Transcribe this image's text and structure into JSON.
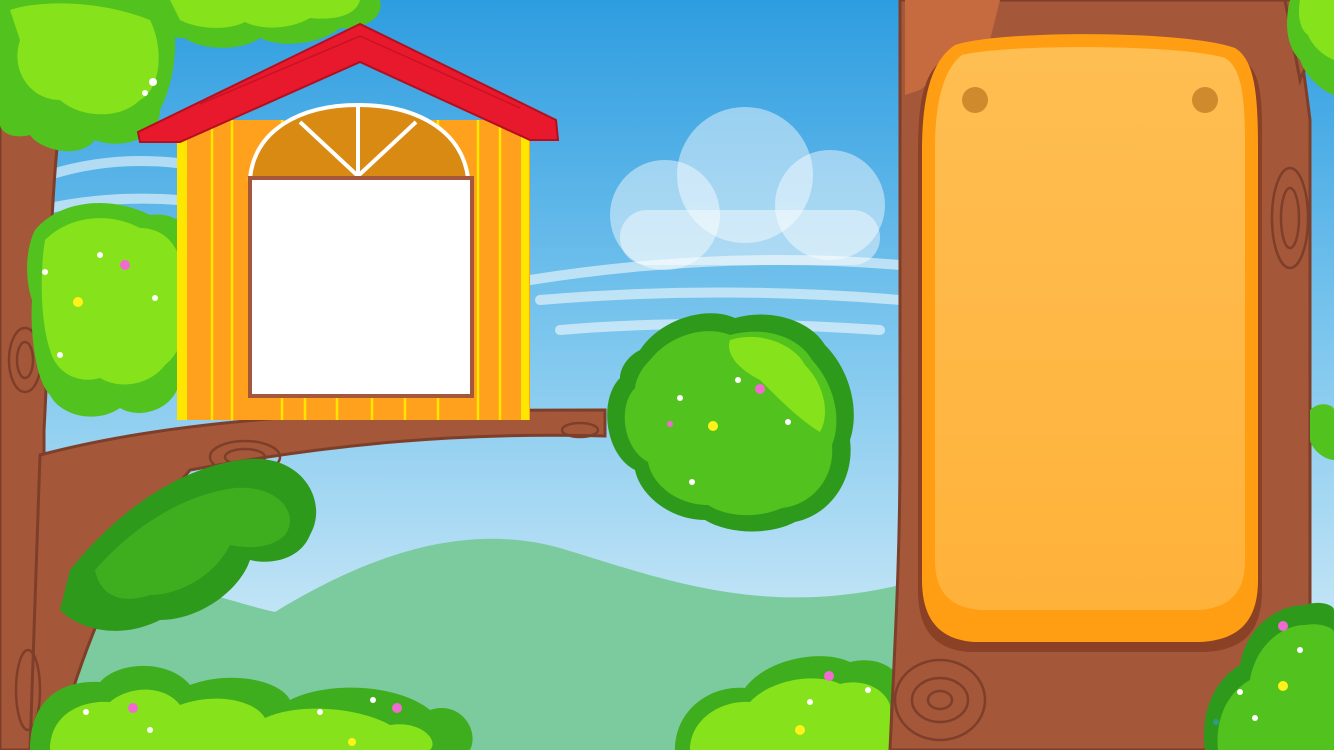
{
  "scene": {
    "kind": "treehouse-game-background",
    "colors": {
      "sky_top": "#2E9DE0",
      "sky_bottom": "#D9EEF8",
      "hill": "#7BCB9E",
      "trunk": "#A5573A",
      "trunk_dark": "#7E3F2A",
      "leaf_light": "#86E21A",
      "leaf": "#52C21E",
      "leaf_dark": "#2E9A1C",
      "roof": "#E8192C",
      "house_wall": "#FFA11C",
      "house_stripe": "#FFE600",
      "panel_rim": "#FF9E12",
      "panel_fill": "#FFB947",
      "window_glass": "#FFFFFF"
    },
    "icons": [
      "treehouse-icon",
      "wooden-sign-icon",
      "cloud-icon",
      "bush-icon"
    ]
  },
  "treehouse": {
    "window": {
      "text": ""
    }
  },
  "sign": {
    "text": ""
  }
}
